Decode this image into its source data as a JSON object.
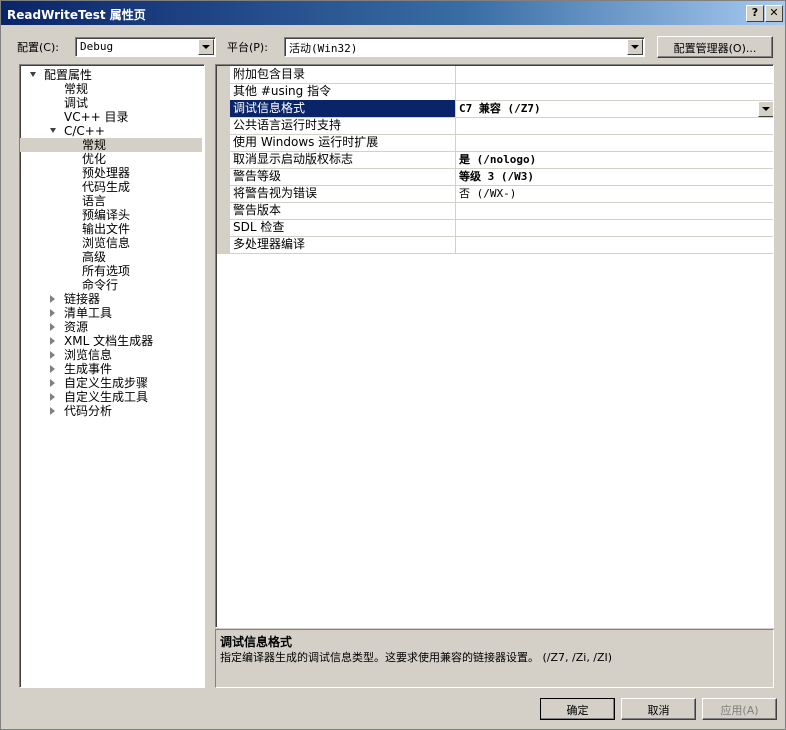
{
  "window": {
    "title": "ReadWriteTest 属性页",
    "help_glyph": "?",
    "close_glyph": "✕"
  },
  "top_bar": {
    "config_label": "配置(C):",
    "config_value": "Debug",
    "platform_label": "平台(P):",
    "platform_value": "活动(Win32)",
    "config_manager_label": "配置管理器(O)..."
  },
  "tree": {
    "items": [
      {
        "label": "配置属性",
        "level": 0,
        "expander": "open"
      },
      {
        "label": "常规",
        "level": 1
      },
      {
        "label": "调试",
        "level": 1
      },
      {
        "label": "VC++ 目录",
        "level": 1
      },
      {
        "label": "C/C++",
        "level": 1,
        "expander": "open"
      },
      {
        "label": "常规",
        "level": 2,
        "selected": true
      },
      {
        "label": "优化",
        "level": 2
      },
      {
        "label": "预处理器",
        "level": 2
      },
      {
        "label": "代码生成",
        "level": 2
      },
      {
        "label": "语言",
        "level": 2
      },
      {
        "label": "预编译头",
        "level": 2
      },
      {
        "label": "输出文件",
        "level": 2
      },
      {
        "label": "浏览信息",
        "level": 2
      },
      {
        "label": "高级",
        "level": 2
      },
      {
        "label": "所有选项",
        "level": 2
      },
      {
        "label": "命令行",
        "level": 2
      },
      {
        "label": "链接器",
        "level": 1,
        "expander": "closed"
      },
      {
        "label": "清单工具",
        "level": 1,
        "expander": "closed"
      },
      {
        "label": "资源",
        "level": 1,
        "expander": "closed"
      },
      {
        "label": "XML 文档生成器",
        "level": 1,
        "expander": "closed"
      },
      {
        "label": "浏览信息",
        "level": 1,
        "expander": "closed"
      },
      {
        "label": "生成事件",
        "level": 1,
        "expander": "closed"
      },
      {
        "label": "自定义生成步骤",
        "level": 1,
        "expander": "closed"
      },
      {
        "label": "自定义生成工具",
        "level": 1,
        "expander": "closed"
      },
      {
        "label": "代码分析",
        "level": 1,
        "expander": "closed"
      }
    ]
  },
  "grid": {
    "rows": [
      {
        "name": "附加包含目录",
        "value": ""
      },
      {
        "name": "其他 #using 指令",
        "value": ""
      },
      {
        "name": "调试信息格式",
        "value": "C7 兼容 (/Z7)",
        "bold": true,
        "selected": true
      },
      {
        "name": "公共语言运行时支持",
        "value": ""
      },
      {
        "name": "使用 Windows 运行时扩展",
        "value": ""
      },
      {
        "name": "取消显示启动版权标志",
        "value": "是 (/nologo)",
        "bold": true
      },
      {
        "name": "警告等级",
        "value": "等级 3 (/W3)",
        "bold": true
      },
      {
        "name": "将警告视为错误",
        "value": "否 (/WX-)"
      },
      {
        "name": "警告版本",
        "value": ""
      },
      {
        "name": "SDL 检查",
        "value": ""
      },
      {
        "name": "多处理器编译",
        "value": ""
      }
    ]
  },
  "description": {
    "title": "调试信息格式",
    "text": "指定编译器生成的调试信息类型。这要求使用兼容的链接器设置。    (/Z7, /Zi, /ZI)"
  },
  "buttons": {
    "ok": "确定",
    "cancel": "取消",
    "apply": "应用(A)"
  },
  "colors": {
    "face": "#d4d0c8",
    "selection": "#0a246a",
    "titlebar": "#0a246a"
  }
}
